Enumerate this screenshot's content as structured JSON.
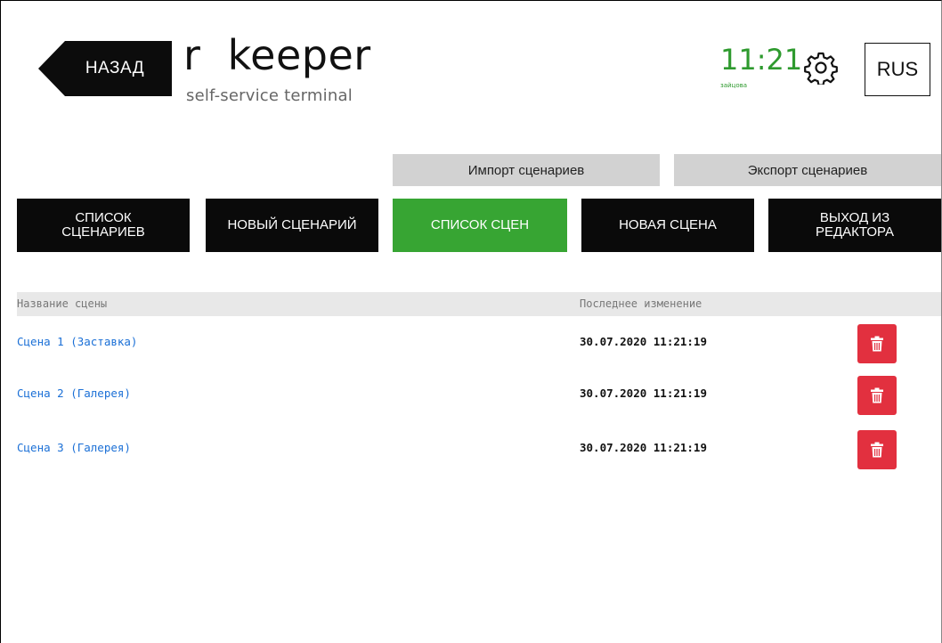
{
  "header": {
    "back_label": "НАЗАД",
    "logo_main": "r  keeper",
    "logo_sub": "self-service terminal",
    "clock_time": "11:21",
    "clock_sub": "зайцова",
    "language": "RUS",
    "accent_color": "#37a533",
    "icons": {
      "settings": "gear-icon",
      "delete": "trash-icon"
    }
  },
  "actions": {
    "import_label": "Импорт сценариев",
    "export_label": "Экспорт сценариев"
  },
  "tabs": [
    {
      "label": "СПИСОК\nСЦЕНАРИЕВ",
      "active": false
    },
    {
      "label": "НОВЫЙ СЦЕНАРИЙ",
      "active": false
    },
    {
      "label": "СПИСОК СЦЕН",
      "active": true
    },
    {
      "label": "НОВАЯ СЦЕНА",
      "active": false
    },
    {
      "label": "ВЫХОД ИЗ\nРЕДАКТОРА",
      "active": false
    }
  ],
  "table": {
    "columns": {
      "name": "Название сцены",
      "modified": "Последнее изменение"
    },
    "rows": [
      {
        "name": "Сцена 1 (Заставка)",
        "modified": "30.07.2020 11:21:19"
      },
      {
        "name": "Сцена 2 (Галерея)",
        "modified": "30.07.2020 11:21:19"
      },
      {
        "name": "Сцена 3 (Галерея)",
        "modified": "30.07.2020 11:21:19"
      }
    ]
  }
}
